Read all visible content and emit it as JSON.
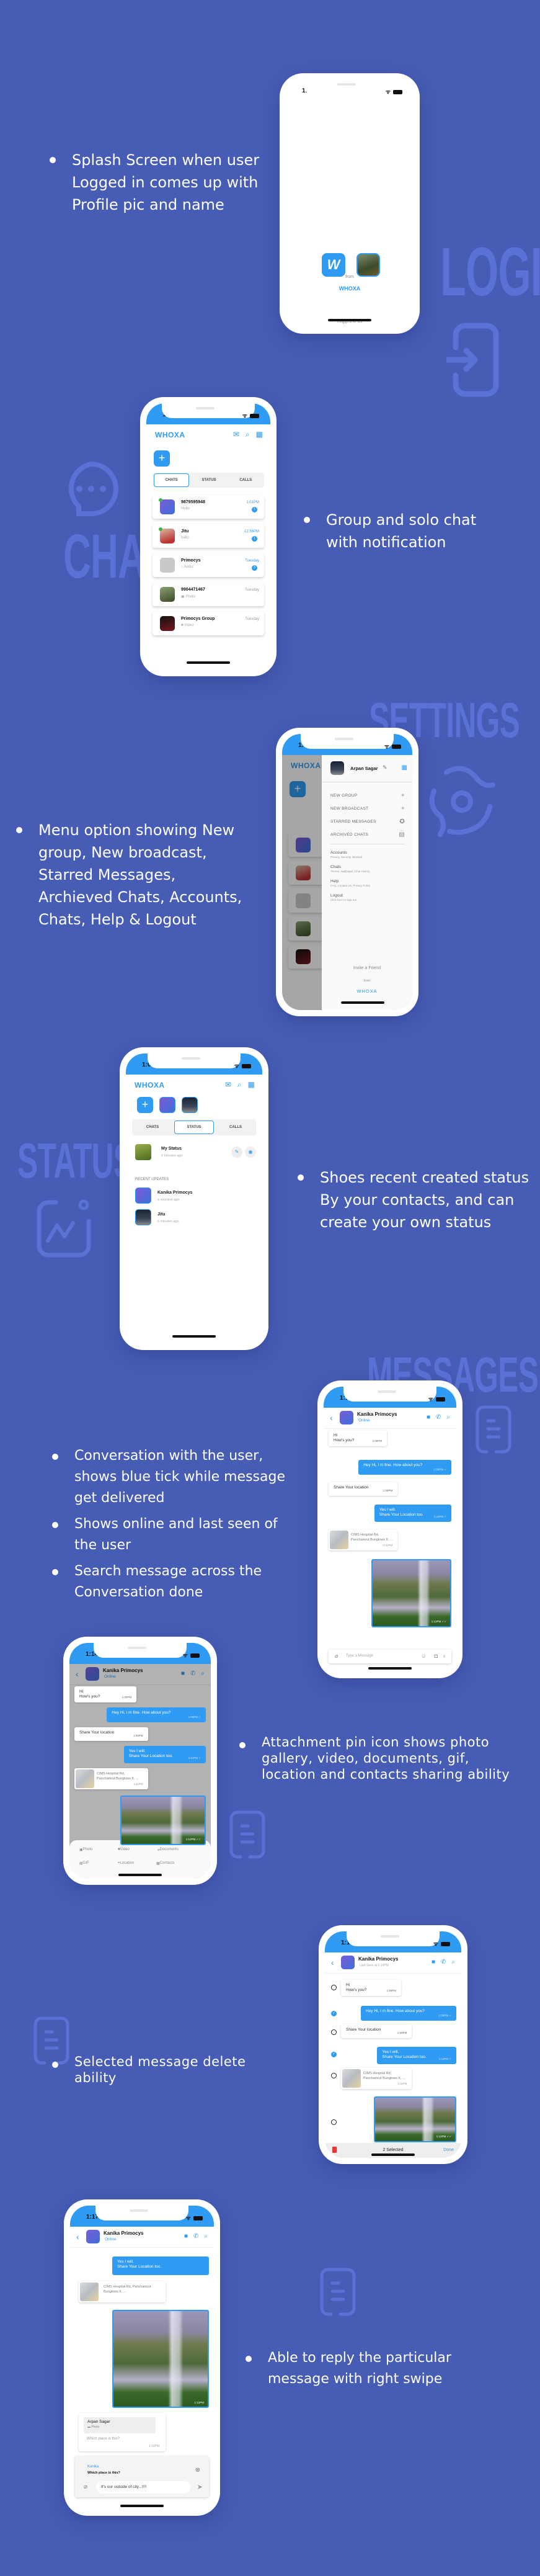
{
  "theme": {
    "background": "#475cb5",
    "accent": "#2f9bf2",
    "watermark": "#5a72d6"
  },
  "sections": {
    "login": {
      "watermark": "LOGIN",
      "bullets": [
        "Splash Screen when user Logged in comes up with Profile pic and name"
      ],
      "phone": {
        "time": "1:05",
        "logo_letter": "W",
        "logged_in_label": "Logged in as",
        "user_name": "Arpan Sagar",
        "from_label": "from",
        "brand": "WHOXA"
      }
    },
    "chat": {
      "watermark": "CHAT",
      "bullets": [
        "Group and solo chat with notification"
      ],
      "phone": {
        "time": "1:02",
        "brand": "WHOXA",
        "tabs": [
          "CHATS",
          "STATUS",
          "CALLS"
        ],
        "active_tab": "CHATS",
        "chats": [
          {
            "name": "9879595948",
            "preview": "Hello",
            "time": "1:01PM",
            "unread": "1",
            "online": true
          },
          {
            "name": "Jitu",
            "preview": "hello",
            "time": "12:56PM",
            "unread": "1",
            "online": true
          },
          {
            "name": "Primocys",
            "preview": "Audio",
            "time": "Tuesday",
            "unread": "3",
            "online": false
          },
          {
            "name": "9904471467",
            "preview": "Photo",
            "time": "Tuesday",
            "unread": "",
            "online": false
          },
          {
            "name": "Primocys Group",
            "preview": "Video",
            "time": "Tuesday",
            "unread": "",
            "online": false
          }
        ]
      }
    },
    "settings": {
      "watermark": "SETTINGS",
      "bullets": [
        "Menu option showing New group, New broadcast, Starred Messages, Archieved Chats, Accounts, Chats, Help & Logout"
      ],
      "phone": {
        "time": "1:07",
        "brand": "WHOXA",
        "profile_name": "Arpan Sagar",
        "menu": [
          {
            "label": "NEW GROUP",
            "icon": "plus-icon"
          },
          {
            "label": "NEW BROADCAST",
            "icon": "plus-icon"
          },
          {
            "label": "STARRED MESSAGES",
            "icon": "star-icon"
          },
          {
            "label": "ARCHIVED CHATS",
            "icon": "archive-icon"
          }
        ],
        "settings": [
          {
            "title": "Accounts",
            "subtitle": "Privacy, Security, Blocked"
          },
          {
            "title": "Chats",
            "subtitle": "Theme, Wallpaper, Chat History"
          },
          {
            "title": "Help",
            "subtitle": "FAQ, Contact Us, Privacy Policy"
          },
          {
            "title": "Logout",
            "subtitle": "Click here to sign out"
          }
        ],
        "invite": "Invite a Friend",
        "from_label": "from",
        "footer_brand": "WHOXA"
      }
    },
    "status": {
      "watermark": "STATUS",
      "bullets": [
        "Shoes recent created status By your contacts, and can create your own status"
      ],
      "phone": {
        "time": "1:08",
        "brand": "WHOXA",
        "tabs": [
          "CHATS",
          "STATUS",
          "CALLS"
        ],
        "active_tab": "STATUS",
        "my_status": {
          "title": "My Status",
          "time": "5 minutes ago"
        },
        "recent_label": "RECENT UPDATES",
        "recent": [
          {
            "name": "Kanika Primocys",
            "time": "a moment ago"
          },
          {
            "name": "Jitu",
            "time": "6 minutes ago"
          }
        ]
      }
    },
    "messages": {
      "watermark": "MESSAGES",
      "bullets": [
        "Conversation with the user, shows blue tick while message get delivered",
        "Shows online and last seen of the user",
        "Search message across the Conversation done"
      ],
      "phone": {
        "time": "1:12",
        "contact": "Kanika Primocys",
        "presence": "Online",
        "input_placeholder": "Type a Message"
      }
    },
    "attachments": {
      "bullets": [
        "Attachment pin icon shows photo gallery, video, documents, gif, location and contacts sharing ability"
      ],
      "phone": {
        "time": "1:14",
        "contact": "Kanika Primocys",
        "presence": "Online",
        "options": [
          "Photo",
          "Video",
          "Documents",
          "GIF",
          "Location",
          "Contacts"
        ]
      }
    },
    "delete": {
      "bullets": [
        "Selected message delete ability"
      ],
      "phone": {
        "time": "1:15",
        "contact": "Kanika Primocys",
        "presence": "Last Seen at 1:14PM",
        "selected_count": "2 Selected",
        "done_label": "Done"
      }
    },
    "reply": {
      "bullets": [
        "Able to reply the particular message with right swipe"
      ],
      "phone": {
        "time": "1:17",
        "contact": "Kanika Primocys",
        "presence": "Online",
        "quoted_sender": "Arpan Sagar",
        "quoted_type": "Photo",
        "reply_text": "Which place is this?",
        "reply_time": "1:16PM",
        "replying_to": "Kanika",
        "replying_to_text": "Which place is this?",
        "input_value": "It's our outside of city...!!!!"
      }
    }
  },
  "conversation": [
    {
      "dir": "in",
      "text": "Hi\nHow's you?",
      "time": "1:09PM"
    },
    {
      "dir": "out",
      "text": "Hey Hi, I m fine. How about you?",
      "time": "1:09PM",
      "selected": true
    },
    {
      "dir": "in",
      "text": "Share Your location",
      "time": "1:09PM"
    },
    {
      "dir": "out",
      "text": "Yes I will.\nShare Your Location too.",
      "time": "1:11PM",
      "selected": true
    },
    {
      "dir": "in",
      "type": "location",
      "text": "CIMS Hospital Rd, Panchamrut Bunglows II, ...",
      "time": "1:11PM"
    },
    {
      "dir": "out",
      "type": "image",
      "time": "1:12PM"
    }
  ]
}
